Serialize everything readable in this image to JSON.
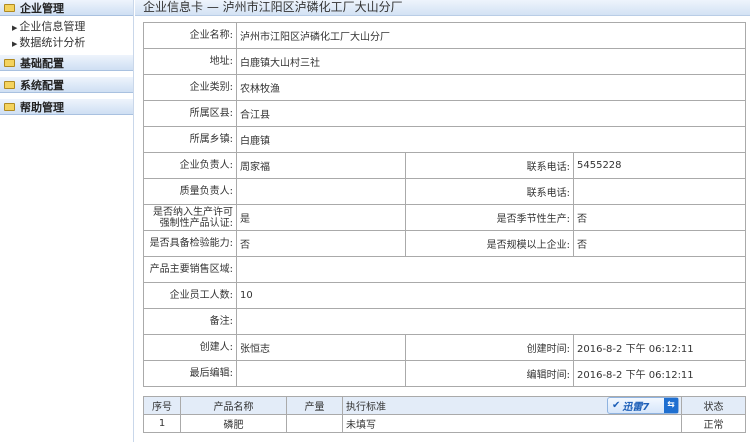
{
  "sidebar": {
    "sections": [
      {
        "label": "企业管理",
        "items": [
          "企业信息管理",
          "数据统计分析"
        ]
      },
      {
        "label": "基础配置"
      },
      {
        "label": "系统配置"
      },
      {
        "label": "帮助管理"
      }
    ]
  },
  "header": {
    "title": "企业信息卡 — 泸州市江阳区泸磷化工厂大山分厂"
  },
  "info": {
    "name_label": "企业名称:",
    "name": "泸州市江阳区泸磷化工厂大山分厂",
    "address_label": "地址:",
    "address": "白鹿镇大山村三社",
    "category_label": "企业类别:",
    "category": "农林牧渔",
    "county_label": "所属区县:",
    "county": "合江县",
    "town_label": "所属乡镇:",
    "town": "白鹿镇",
    "leader_label": "企业负责人:",
    "leader": "周家福",
    "phone1_label": "联系电话:",
    "phone1": "5455228",
    "quality_label": "质量负责人:",
    "quality": "",
    "phone2_label": "联系电话:",
    "phone2": "",
    "license_label": "是否纳入生产许可强制性产品认证:",
    "license": "是",
    "seasonal_label": "是否季节性生产:",
    "seasonal": "否",
    "inspect_label": "是否具备检验能力:",
    "inspect": "否",
    "scale_label": "是否规模以上企业:",
    "scale": "否",
    "sales_label": "产品主要销售区域:",
    "sales": "",
    "staff_label": "企业员工人数:",
    "staff": "10",
    "note_label": "备注:",
    "note": "",
    "creator_label": "创建人:",
    "creator": "张恒志",
    "ctime_label": "创建时间:",
    "ctime": "2016-8-2 下午 06:12:11",
    "editor_label": "最后编辑:",
    "editor": "",
    "etime_label": "编辑时间:",
    "etime": "2016-8-2 下午 06:12:11"
  },
  "products": {
    "headers": [
      "序号",
      "产品名称",
      "产量",
      "执行标准",
      "状态"
    ],
    "rows": [
      [
        "1",
        "磷肥",
        "",
        "未填写",
        "正常"
      ]
    ]
  },
  "overlay": {
    "label": "迅雷7",
    "switch": "⇆"
  }
}
